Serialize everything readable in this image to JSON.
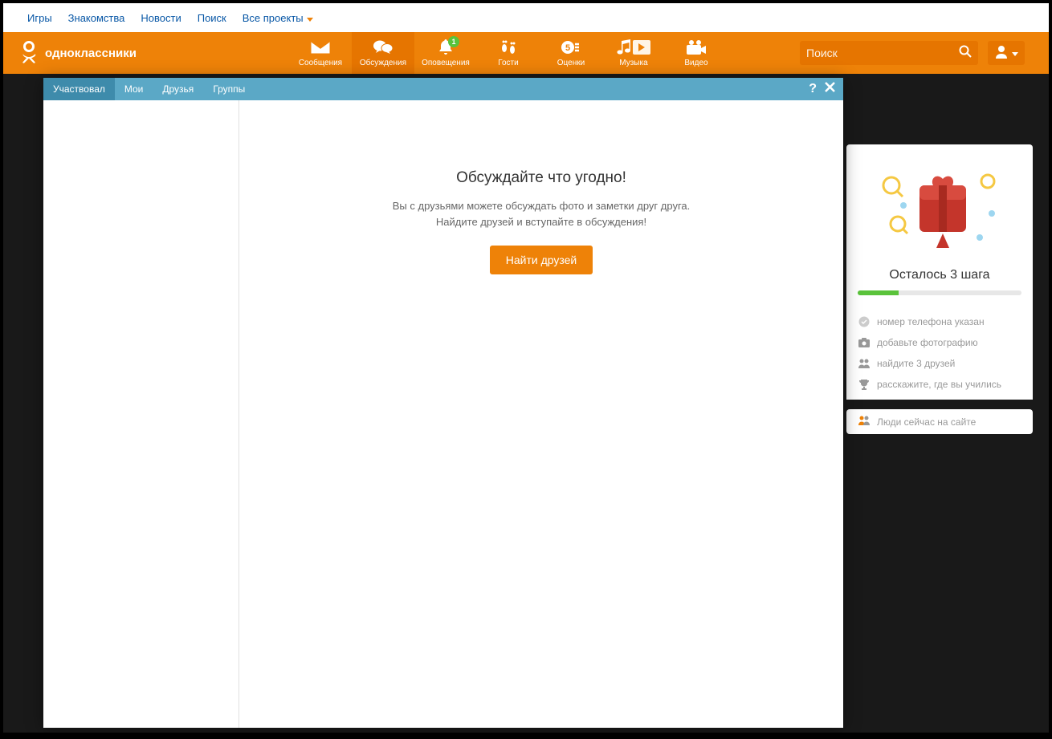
{
  "top_links": {
    "games": "Игры",
    "dating": "Знакомства",
    "news": "Новости",
    "search": "Поиск",
    "all_projects": "Все проекты"
  },
  "logo": {
    "text": "одноклассники"
  },
  "nav": {
    "items": [
      {
        "label": "Сообщения"
      },
      {
        "label": "Обсуждения"
      },
      {
        "label": "Оповещения",
        "badge": "1"
      },
      {
        "label": "Гости"
      },
      {
        "label": "Оценки"
      },
      {
        "label": "Музыка"
      }
    ],
    "video_label": "Видео"
  },
  "search": {
    "placeholder": "Поиск"
  },
  "sidebar": {
    "steps_title": "Осталось 3 шага",
    "steps": [
      {
        "label": "номер телефона указан"
      },
      {
        "label": "добавьте фотографию"
      },
      {
        "label": "найдите 3 друзей"
      },
      {
        "label": "расскажите, где вы учились"
      }
    ],
    "online_users": "Люди сейчас на сайте"
  },
  "modal": {
    "tabs": {
      "participated": "Участвовал",
      "mine": "Мои",
      "friends": "Друзья",
      "groups": "Группы"
    },
    "title": "Обсуждайте что угодно!",
    "desc_line1": "Вы с друзьями можете обсуждать фото и заметки друг друга.",
    "desc_line2": "Найдите друзей и вступайте в обсуждения!",
    "find_button": "Найти друзей"
  }
}
